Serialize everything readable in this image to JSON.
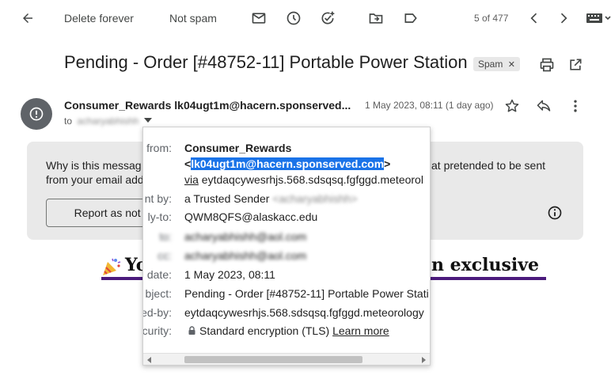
{
  "toolbar": {
    "delete_forever": "Delete forever",
    "not_spam": "Not spam",
    "page_count": "5 of 477"
  },
  "email": {
    "subject": "Pending - Order [#48752-11] Portable Power Station",
    "spam_label": "Spam",
    "sender_name": "Consumer_Rewards",
    "sender_email": "lk04ugt1m@hacern.sponserved...",
    "date": "1 May 2023, 08:11 (1 day ago)",
    "to_label": "to",
    "to_value": "acharyabhishh"
  },
  "warning": {
    "line1": "Why is this messag",
    "line1_right": "at pretended to be sent",
    "line2": "from your email add",
    "report_button": "Report as not sp"
  },
  "banner": {
    "left_text": "Yo",
    "right_text": "n exclusive"
  },
  "details": {
    "rows": [
      {
        "label": "from:",
        "value": "Consumer_Rewards"
      },
      {
        "label": "",
        "value_prefix": "<",
        "value_highlight": "lk04ugt1m@hacern.sponserved.com",
        "value_suffix": ">"
      },
      {
        "label": "",
        "via": "via",
        "value": " eytdaqcywesrhjs.568.sdsqsq.fgfggd.meteorol"
      },
      {
        "label": "nt by:",
        "value": "a Trusted Sender",
        "blurred": "<acharyabhishh>"
      },
      {
        "label": "ly-to:",
        "value": "QWM8QFS@alaskacc.edu"
      },
      {
        "label": "to:",
        "blurred": "acharyabhishh@aol.com"
      },
      {
        "label": "cc:",
        "blurred": "acharyabhishh@aol.com"
      },
      {
        "label": "date:",
        "value": "1 May 2023, 08:11"
      },
      {
        "label": "bject:",
        "value": "Pending - Order [#48752-11] Portable Power Stati"
      },
      {
        "label": "ed-by:",
        "value": "eytdaqcywesrhjs.568.sdsqsq.fgfggd.meteorology"
      },
      {
        "label": "curity:",
        "value": "Standard encryption (TLS)",
        "link": "Learn more"
      }
    ]
  },
  "icons": [
    "back-arrow-icon",
    "mail-icon",
    "clock-icon",
    "add-task-icon",
    "move-to-icon",
    "label-icon",
    "chevron-left-icon",
    "chevron-right-icon",
    "keyboard-icon",
    "print-icon",
    "open-in-new-icon",
    "star-icon",
    "reply-icon",
    "more-vert-icon",
    "info-icon",
    "lock-icon"
  ]
}
